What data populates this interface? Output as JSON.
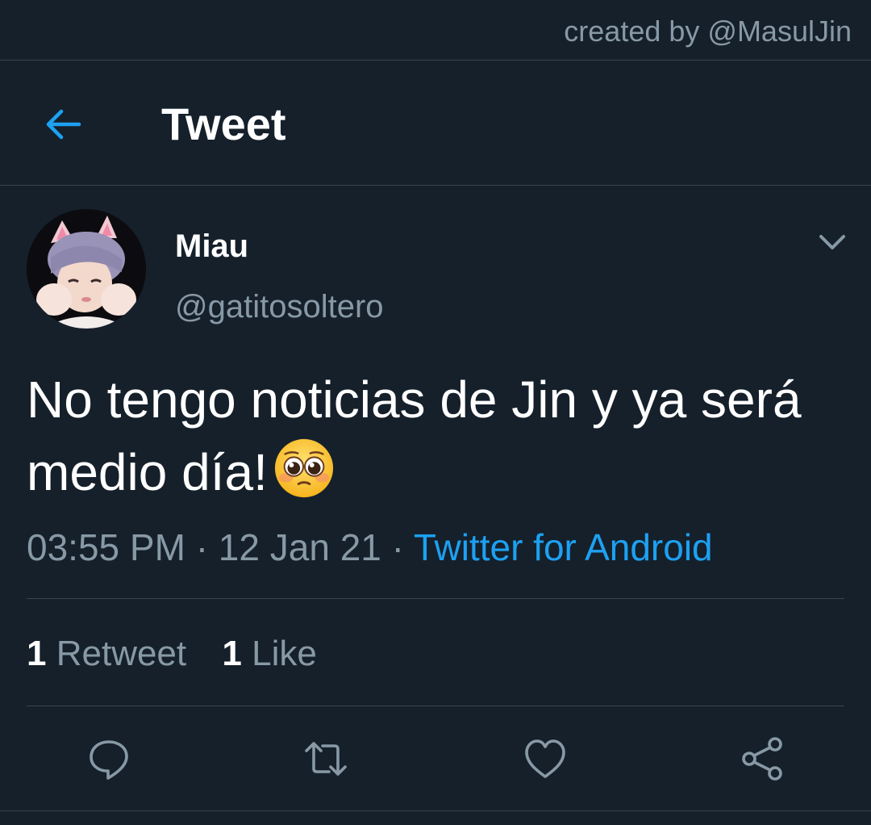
{
  "watermark": "created by @MasulJin",
  "header": {
    "title": "Tweet",
    "back_icon": "arrow-left-icon"
  },
  "colors": {
    "background": "#15202b",
    "accent": "#1da1f2",
    "secondary_text": "#8899a6",
    "divider": "#38444d"
  },
  "tweet": {
    "display_name": "Miau",
    "handle": "@gatitosoltero",
    "text": "No tengo noticias de Jin y ya será medio día!",
    "emoji": "pleading-face-emoji",
    "time": "03:55 PM",
    "date": "12 Jan 21",
    "separator": "·",
    "source": "Twitter for Android"
  },
  "stats": {
    "retweets_count": "1",
    "retweets_label": "Retweet",
    "likes_count": "1",
    "likes_label": "Like"
  },
  "actions": [
    {
      "name": "reply",
      "icon": "reply-bubble-icon"
    },
    {
      "name": "retweet",
      "icon": "retweet-icon"
    },
    {
      "name": "like",
      "icon": "heart-icon"
    },
    {
      "name": "share",
      "icon": "share-icon"
    }
  ]
}
